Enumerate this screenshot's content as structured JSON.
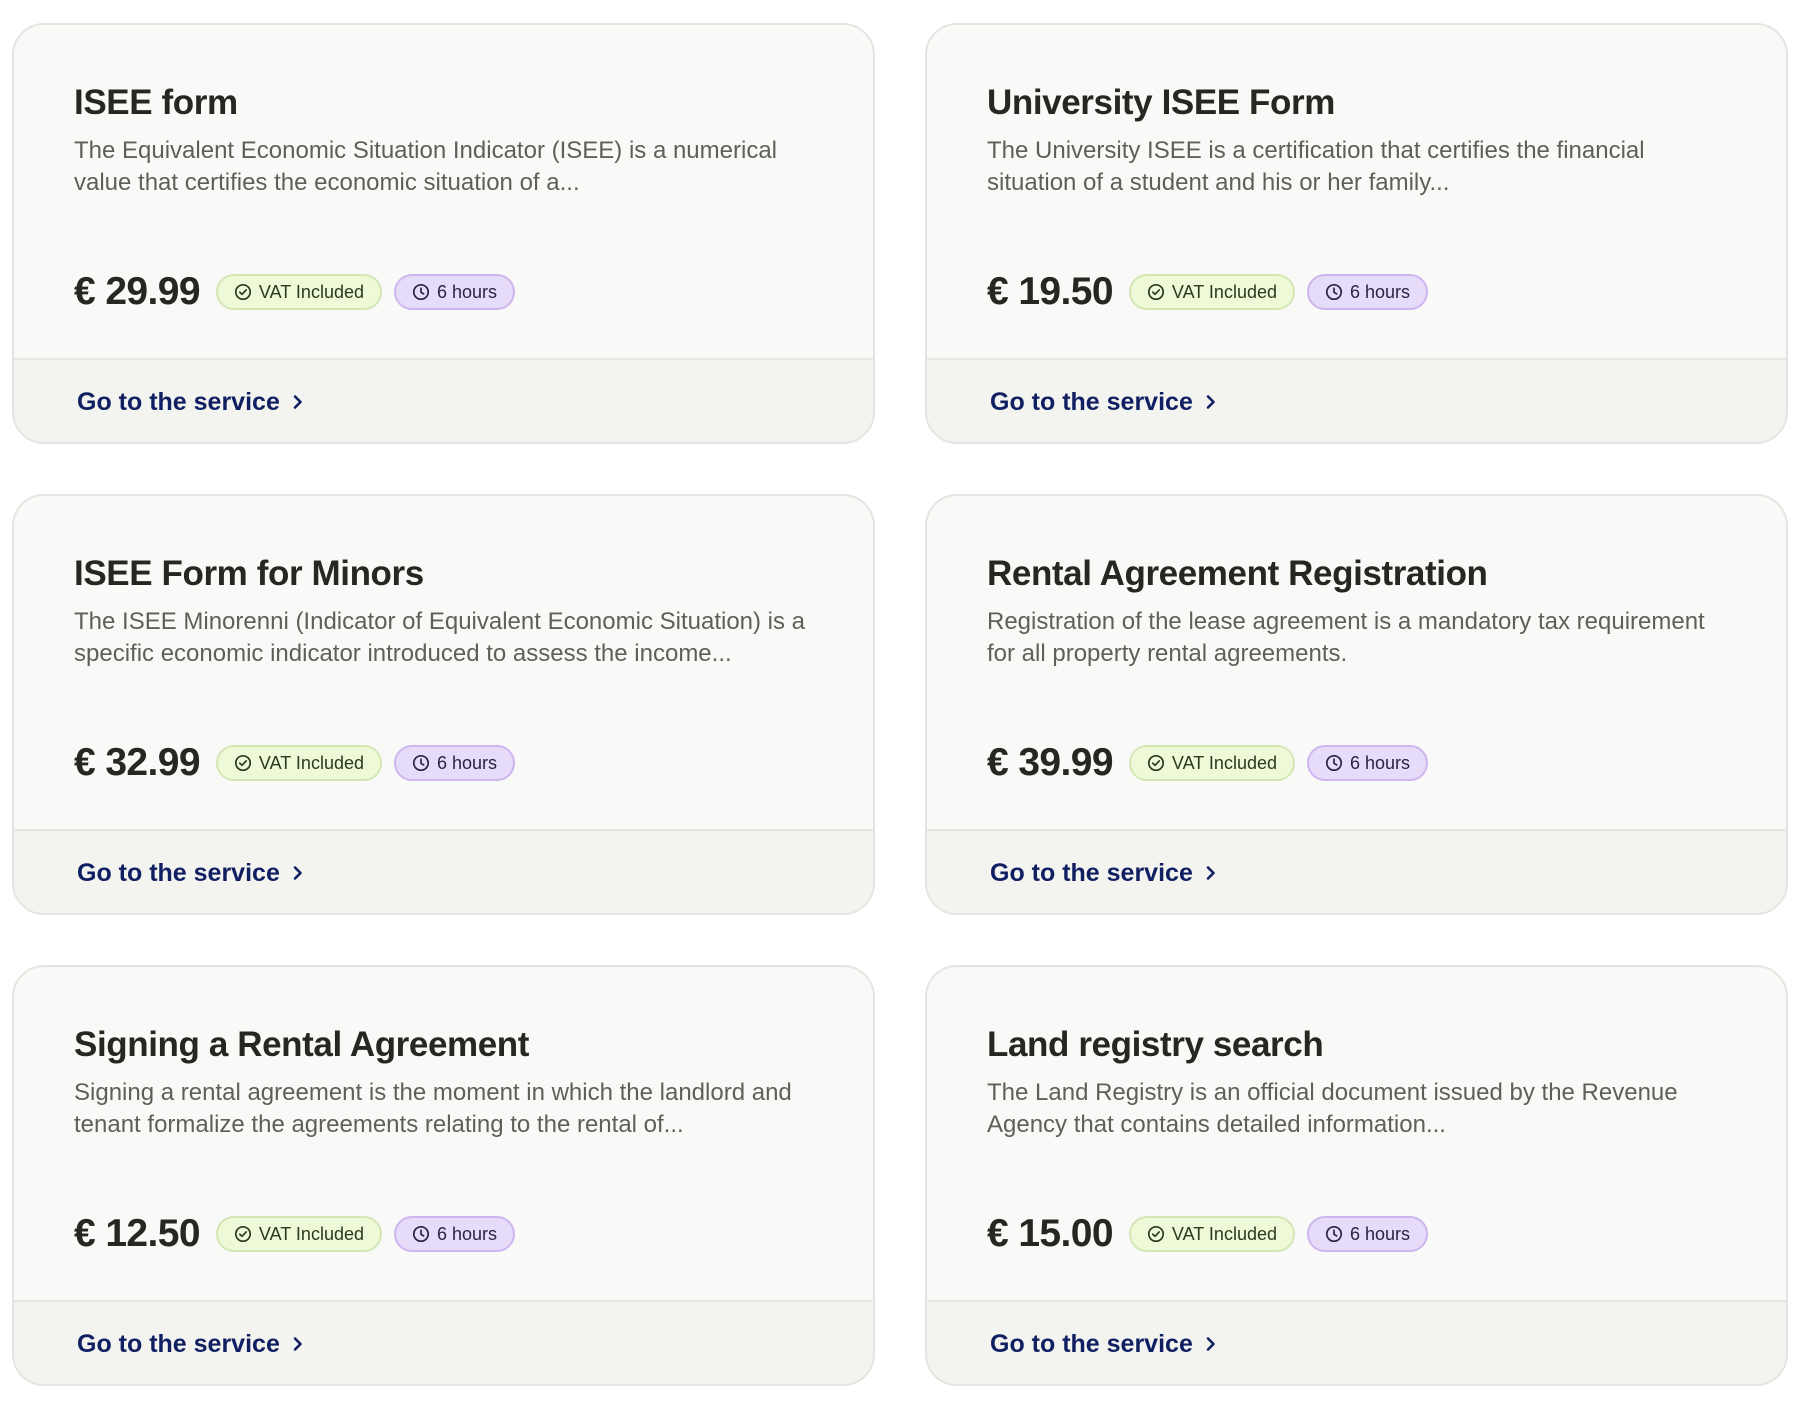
{
  "common": {
    "link_label": "Go to the service",
    "vat_label": "VAT Included",
    "time_label": "6 hours"
  },
  "icons": {
    "vat": "check-circle-icon",
    "time": "clock-icon",
    "link": "chevron-right-icon"
  },
  "colors": {
    "link": "#0f1f62",
    "vat_badge_bg": "#eef9d8",
    "time_badge_bg": "#e7dbfa"
  },
  "cards": [
    {
      "title": "ISEE form",
      "description": "The Equivalent Economic Situation Indicator (ISEE) is a numerical value that certifies the economic situation of a...",
      "price": "€ 29.99"
    },
    {
      "title": "University ISEE Form",
      "description": "The University ISEE is a certification that certifies the financial situation of a student and his or her family...",
      "price": "€ 19.50"
    },
    {
      "title": "ISEE Form for Minors",
      "description": "The ISEE Minorenni (Indicator of Equivalent Economic Situation) is a specific economic indicator introduced to assess the income...",
      "price": "€ 32.99"
    },
    {
      "title": "Rental Agreement Registration",
      "description": "Registration of the lease agreement is a mandatory tax requirement for all property rental agreements.",
      "price": "€ 39.99"
    },
    {
      "title": "Signing a Rental Agreement",
      "description": "Signing a rental agreement is the moment in which the landlord and tenant formalize the agreements relating to the rental of...",
      "price": "€ 12.50"
    },
    {
      "title": "Land registry search",
      "description": "The Land Registry is an official document issued by the Revenue Agency that contains detailed information...",
      "price": "€ 15.00"
    }
  ]
}
